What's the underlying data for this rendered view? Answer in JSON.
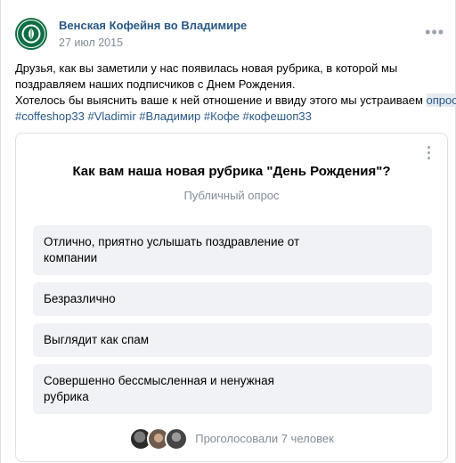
{
  "post": {
    "author": "Венская Кофейня во Владимире",
    "date": "27 июл 2015",
    "menu_icon": "more-horizontal-icon",
    "text": {
      "line1": "Друзья, как вы заметили у нас появилась новая рубрика, в которой мы",
      "line2": "поздравляем наших подписчиков с Днем Рождения.",
      "line3_before": "Хотелось бы выяснить ваше к ней отношение и ввиду этого мы устраиваем ",
      "line3_link": "опрос",
      "line3_after": "."
    },
    "hashtags": [
      "#coffeshop33",
      "#Vladimir",
      "#Владимир",
      "#Кофе",
      "#кофешоп33"
    ]
  },
  "poll": {
    "menu_icon": "more-vertical-icon",
    "question": "Как вам наша новая рубрика \"День Рождения\"?",
    "type": "Публичный опрос",
    "options": [
      {
        "line1": "Отлично, приятно услышать поздравление от",
        "line2": "компании"
      },
      {
        "line1": "Безразлично",
        "line2": ""
      },
      {
        "line1": "Выглядит как спам",
        "line2": ""
      },
      {
        "line1": "Совершенно бессмысленная и ненужная",
        "line2": "рубрика"
      }
    ],
    "voters_text": "Проголосовали 7 человек"
  },
  "colors": {
    "link": "#2a5885",
    "secondary": "#818c99",
    "option_bg": "#f0f2f5",
    "brand": "#0f6e43"
  }
}
